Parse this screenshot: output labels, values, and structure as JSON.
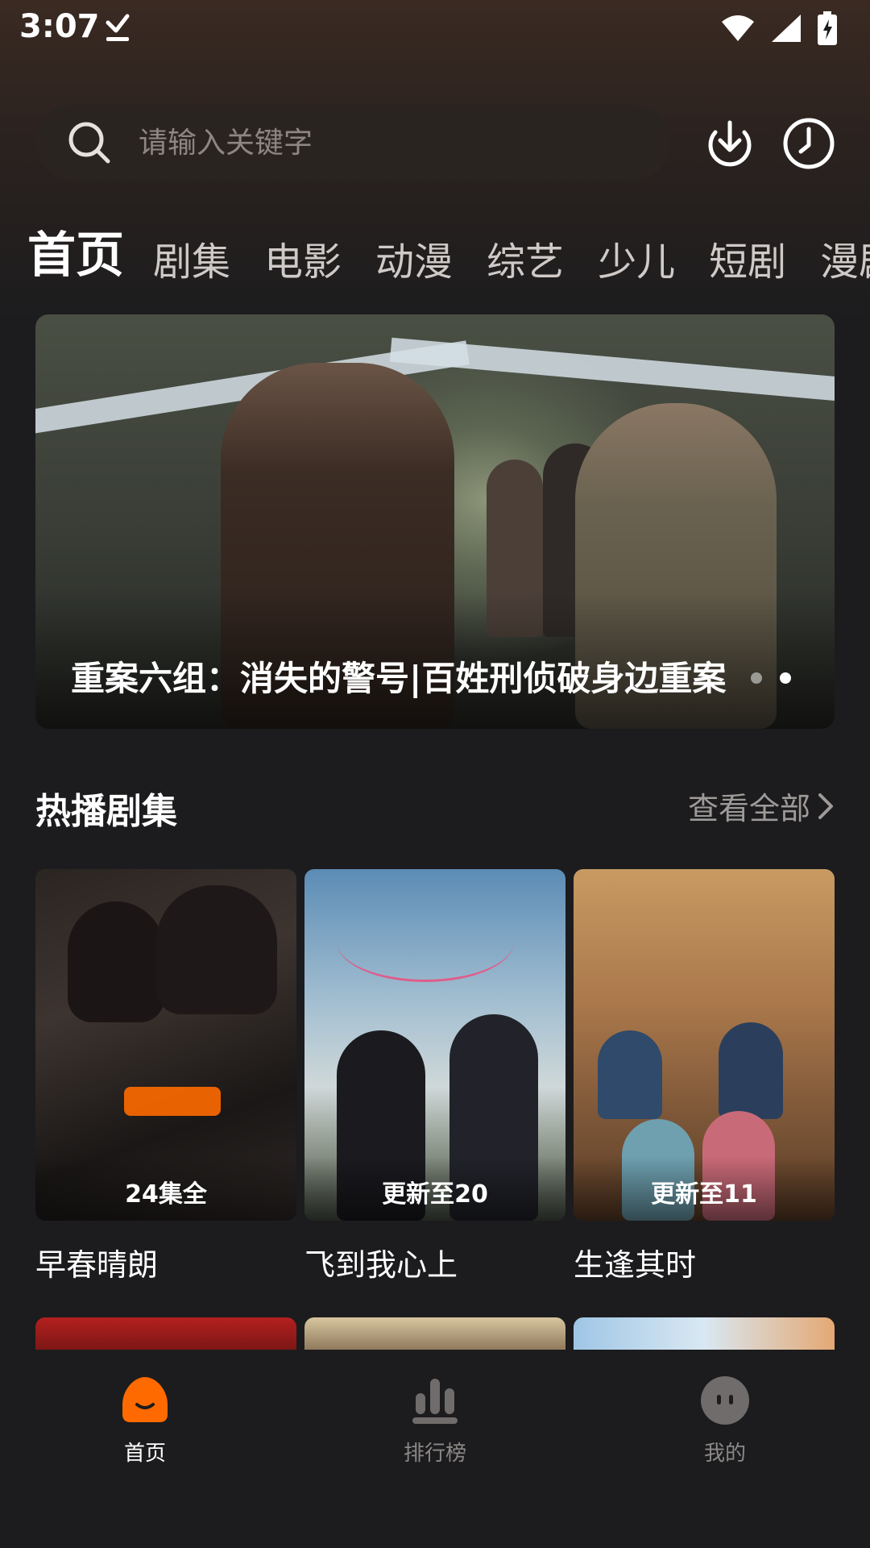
{
  "status_bar": {
    "time": "3:07"
  },
  "search": {
    "placeholder": "请输入关键字"
  },
  "tabs": [
    "首页",
    "剧集",
    "电影",
    "动漫",
    "综艺",
    "少儿",
    "短剧",
    "漫剧"
  ],
  "banner": {
    "title": "重案六组：消失的警号|百姓刑侦破身边重案",
    "dots_total": 2,
    "dots_active_index": 1
  },
  "section": {
    "title": "热播剧集",
    "see_all": "查看全部"
  },
  "shows": [
    {
      "title": "早春晴朗",
      "badge": "24集全"
    },
    {
      "title": "飞到我心上",
      "badge": "更新至20"
    },
    {
      "title": "生逢其时",
      "badge": "更新至11"
    }
  ],
  "nav": {
    "home": "首页",
    "ranking": "排行榜",
    "mine": "我的"
  },
  "colors": {
    "accent": "#ff6a00",
    "background": "#1c1c1e"
  }
}
